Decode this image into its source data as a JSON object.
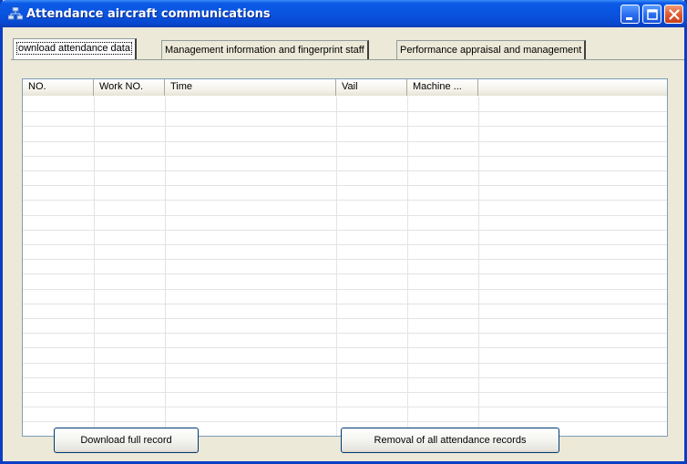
{
  "window": {
    "title": "Attendance aircraft communications",
    "controls": [
      "minimize-icon",
      "maximize-icon",
      "close-icon"
    ],
    "title_color": "#0a54e0"
  },
  "tabs": [
    {
      "label": "ownload attendance data",
      "active": true
    },
    {
      "label": "Management information and fingerprint staff",
      "active": false
    },
    {
      "label": "Performance appraisal and management",
      "active": false
    }
  ],
  "table": {
    "columns": [
      "NO.",
      "Work NO.",
      "Time",
      "Vail",
      "Machine ..."
    ],
    "rows": []
  },
  "buttons": {
    "download": "Download full record",
    "remove": "Removal of all attendance records"
  }
}
